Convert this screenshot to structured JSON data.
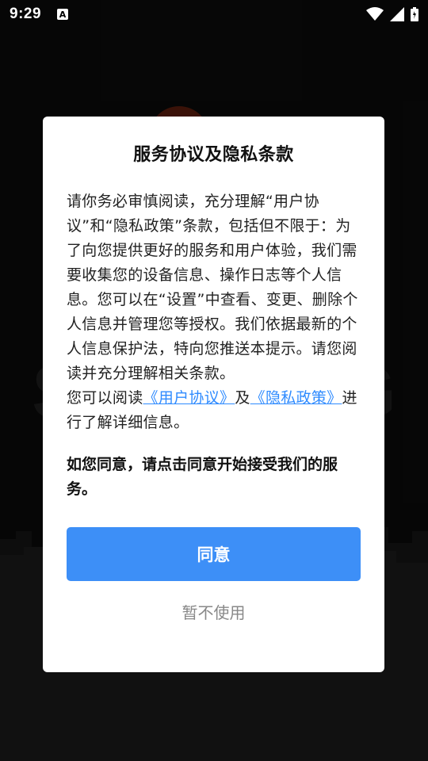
{
  "status_bar": {
    "time": "9:29",
    "notification_icon_letter": "A"
  },
  "background": {
    "left_glyph": "S",
    "right_glyph": "G"
  },
  "dialog": {
    "title": "服务协议及隐私条款",
    "paragraph_1": "请你务必审慎阅读，充分理解“用户协议”和“隐私政策”条款，包括但不限于：为了向您提供更好的服务和用户体验，我们需要收集您的设备信息、操作日志等个人信息。您可以在“设置”中查看、变更、删除个人信息并管理您等授权。我们依据最新的个人信息保护法，特向您推送本提示。请您阅读并充分理解相关条款。",
    "links_prefix": "您可以阅读",
    "user_agreement_link": "《用户协议》",
    "links_and": "及",
    "privacy_policy_link": "《隐私政策》",
    "links_suffix": "进行了解详细信息。",
    "consent_text": "如您同意，请点击同意开始接受我们的服务。",
    "agree_label": "同意",
    "decline_label": "暂不使用"
  },
  "colors": {
    "accent": "#3d8ff7",
    "link": "#2f8bff",
    "decline_text": "#888888"
  }
}
